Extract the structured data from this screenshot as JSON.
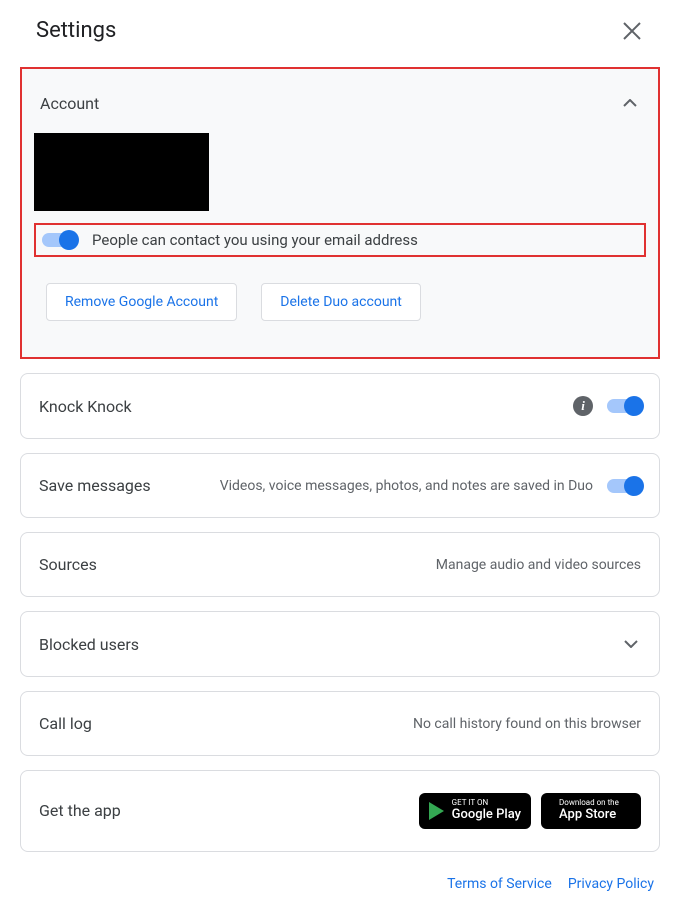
{
  "header": {
    "title": "Settings"
  },
  "account": {
    "title": "Account",
    "email_toggle_label": "People can contact you using your email address",
    "remove_google_label": "Remove Google Account",
    "delete_duo_label": "Delete Duo account"
  },
  "knock_knock": {
    "title": "Knock Knock"
  },
  "save_messages": {
    "title": "Save messages",
    "desc": "Videos, voice messages, photos, and notes are saved in Duo"
  },
  "sources": {
    "title": "Sources",
    "desc": "Manage audio and video sources"
  },
  "blocked": {
    "title": "Blocked users"
  },
  "call_log": {
    "title": "Call log",
    "desc": "No call history found on this browser"
  },
  "get_app": {
    "title": "Get the app",
    "google_play_small": "GET IT ON",
    "google_play_big": "Google Play",
    "app_store_small": "Download on the",
    "app_store_big": "App Store"
  },
  "footer": {
    "tos": "Terms of Service",
    "privacy": "Privacy Policy"
  }
}
